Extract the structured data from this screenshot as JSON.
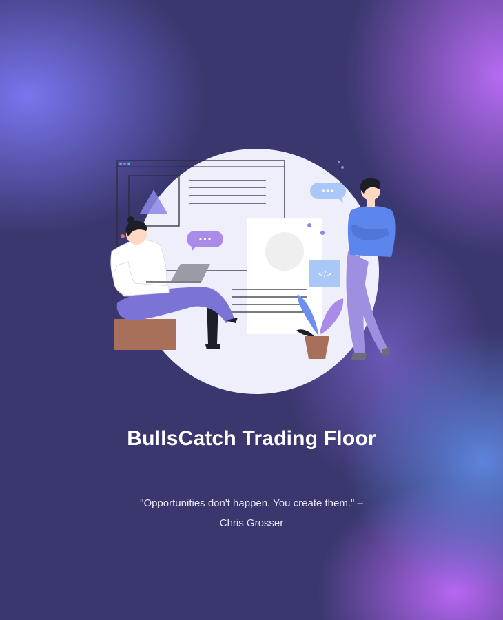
{
  "page": {
    "title": "BullsCatch Trading Floor",
    "quote_line1": "\"Opportunities don't happen. You create them.\" –",
    "quote_line2": "Chris Grosser"
  },
  "illustration": {
    "bubble_text": "•••",
    "code_tag": "</>"
  },
  "colors": {
    "background": "#3a376f",
    "circle": "#efeffb",
    "accent_purple": "#a98bea",
    "accent_blue": "#6f8ff0"
  }
}
